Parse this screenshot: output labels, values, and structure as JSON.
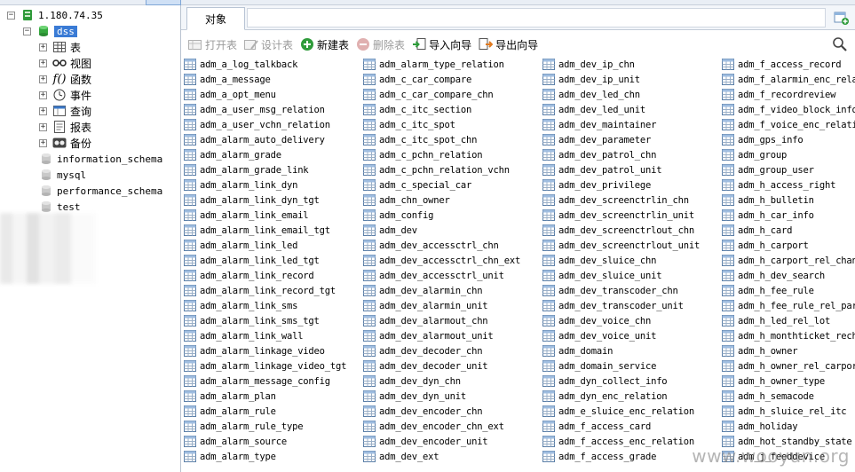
{
  "tree": {
    "connection": {
      "label": "1.180.74.35",
      "icon": "connection-icon"
    },
    "selected_db": {
      "label": "dss",
      "icon": "database-icon"
    },
    "children": [
      {
        "label": "表",
        "icon": "table-folder-icon"
      },
      {
        "label": "视图",
        "icon": "view-glasses-icon"
      },
      {
        "label": "函数",
        "icon": "function-icon"
      },
      {
        "label": "事件",
        "icon": "event-clock-icon"
      },
      {
        "label": "查询",
        "icon": "query-icon"
      },
      {
        "label": "报表",
        "icon": "report-icon"
      },
      {
        "label": "备份",
        "icon": "backup-icon"
      }
    ],
    "other_dbs": [
      {
        "label": "information_schema"
      },
      {
        "label": "mysql"
      },
      {
        "label": "performance_schema"
      },
      {
        "label": "test"
      }
    ]
  },
  "tabs": {
    "objects_label": "对象"
  },
  "toolbar": {
    "open_table": "打开表",
    "design_table": "设计表",
    "new_table": "新建表",
    "delete_table": "删除表",
    "import_wizard": "导入向导",
    "export_wizard": "导出向导"
  },
  "tables": {
    "col1": [
      "adm_a_log_talkback",
      "adm_a_message",
      "adm_a_opt_menu",
      "adm_a_user_msg_relation",
      "adm_a_user_vchn_relation",
      "adm_alarm_auto_delivery",
      "adm_alarm_grade",
      "adm_alarm_grade_link",
      "adm_alarm_link_dyn",
      "adm_alarm_link_dyn_tgt",
      "adm_alarm_link_email",
      "adm_alarm_link_email_tgt",
      "adm_alarm_link_led",
      "adm_alarm_link_led_tgt",
      "adm_alarm_link_record",
      "adm_alarm_link_record_tgt",
      "adm_alarm_link_sms",
      "adm_alarm_link_sms_tgt",
      "adm_alarm_link_wall",
      "adm_alarm_linkage_video",
      "adm_alarm_linkage_video_tgt",
      "adm_alarm_message_config",
      "adm_alarm_plan",
      "adm_alarm_rule",
      "adm_alarm_rule_type",
      "adm_alarm_source",
      "adm_alarm_type"
    ],
    "col2": [
      "adm_alarm_type_relation",
      "adm_c_car_compare",
      "adm_c_car_compare_chn",
      "adm_c_itc_section",
      "adm_c_itc_spot",
      "adm_c_itc_spot_chn",
      "adm_c_pchn_relation",
      "adm_c_pchn_relation_vchn",
      "adm_c_special_car",
      "adm_chn_owner",
      "adm_config",
      "adm_dev",
      "adm_dev_accessctrl_chn",
      "adm_dev_accessctrl_chn_ext",
      "adm_dev_accessctrl_unit",
      "adm_dev_alarmin_chn",
      "adm_dev_alarmin_unit",
      "adm_dev_alarmout_chn",
      "adm_dev_alarmout_unit",
      "adm_dev_decoder_chn",
      "adm_dev_decoder_unit",
      "adm_dev_dyn_chn",
      "adm_dev_dyn_unit",
      "adm_dev_encoder_chn",
      "adm_dev_encoder_chn_ext",
      "adm_dev_encoder_unit",
      "adm_dev_ext"
    ],
    "col3": [
      "adm_dev_ip_chn",
      "adm_dev_ip_unit",
      "adm_dev_led_chn",
      "adm_dev_led_unit",
      "adm_dev_maintainer",
      "adm_dev_parameter",
      "adm_dev_patrol_chn",
      "adm_dev_patrol_unit",
      "adm_dev_privilege",
      "adm_dev_screenctrlin_chn",
      "adm_dev_screenctrlin_unit",
      "adm_dev_screenctrlout_chn",
      "adm_dev_screenctrlout_unit",
      "adm_dev_sluice_chn",
      "adm_dev_sluice_unit",
      "adm_dev_transcoder_chn",
      "adm_dev_transcoder_unit",
      "adm_dev_voice_chn",
      "adm_dev_voice_unit",
      "adm_domain",
      "adm_domain_service",
      "adm_dyn_collect_info",
      "adm_dyn_enc_relation",
      "adm_e_sluice_enc_relation",
      "adm_f_access_card",
      "adm_f_access_enc_relation",
      "adm_f_access_grade"
    ],
    "col4": [
      "adm_f_access_record",
      "adm_f_alarmin_enc_rela",
      "adm_f_recordreview",
      "adm_f_video_block_info",
      "adm_f_voice_enc_relati",
      "adm_gps_info",
      "adm_group",
      "adm_group_user",
      "adm_h_access_right",
      "adm_h_bulletin",
      "adm_h_car_info",
      "adm_h_card",
      "adm_h_carport",
      "adm_h_carport_rel_chan",
      "adm_h_dev_search",
      "adm_h_fee_rule",
      "adm_h_fee_rule_rel_par",
      "adm_h_led_rel_lot",
      "adm_h_monthticket_rech",
      "adm_h_owner",
      "adm_h_owner_rel_carpor",
      "adm_h_owner_type",
      "adm_h_semacode",
      "adm_h_sluice_rel_itc",
      "adm_holiday",
      "adm_hot_standby_state",
      "adm_j_feeddevice"
    ]
  },
  "watermark": "www.wooyun.org"
}
